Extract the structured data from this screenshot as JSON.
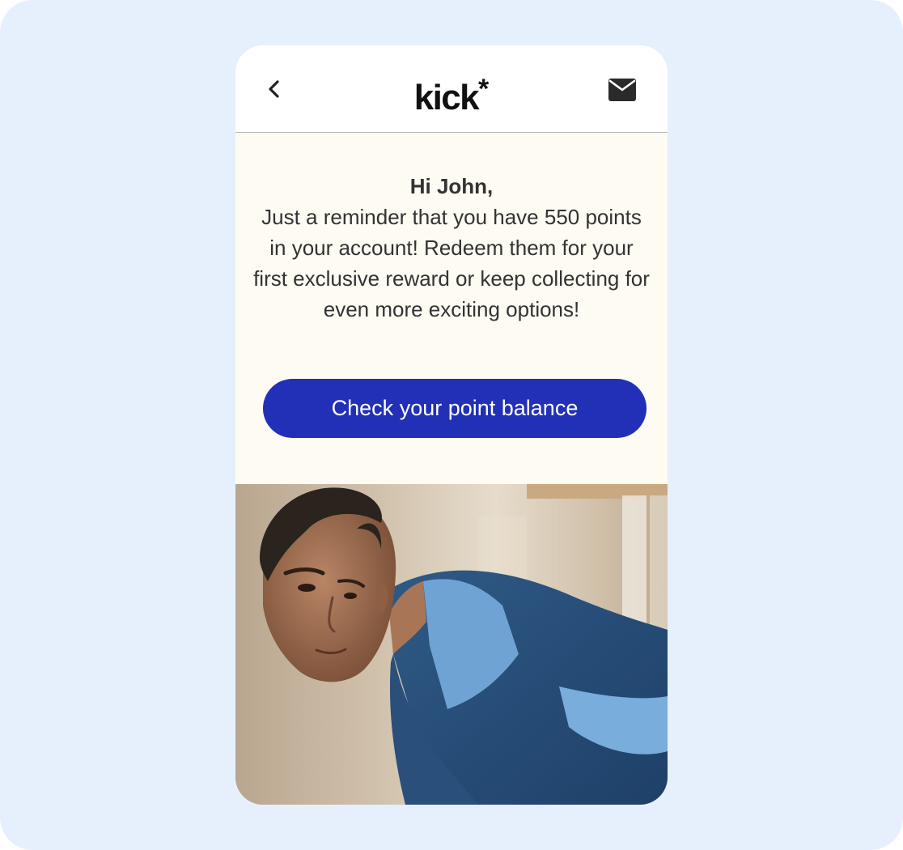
{
  "header": {
    "logo_text": "kick",
    "logo_mark": "*",
    "back_icon": "chevron-left-icon",
    "mail_icon": "envelope-icon"
  },
  "message": {
    "greeting": "Hi John,",
    "body": "Just a reminder that you have 550 points in your account! Redeem them for your first exclusive reward or keep collecting for even more exciting options!"
  },
  "cta": {
    "label": "Check your point balance"
  },
  "colors": {
    "backdrop": "#e6f0fd",
    "card_background": "#fdfbf2",
    "button": "#2230b8",
    "button_text": "#ffffff",
    "text": "#333333"
  }
}
